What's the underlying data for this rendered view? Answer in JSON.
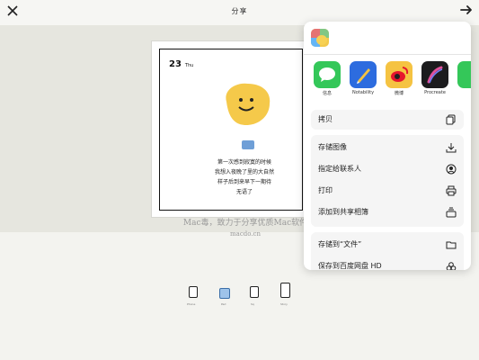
{
  "window": {
    "title": "分享"
  },
  "card": {
    "date_day": "23",
    "date_suffix": "Thu",
    "poem": [
      "第一次感到寂寞的时候",
      "我想入夜晚了里的大自然",
      "样子后到来早下一期待",
      "无语了"
    ]
  },
  "watermark": {
    "line1": "Mac毒，致力于分享优质Mac软件",
    "line2": "macdo.cn"
  },
  "frames": {
    "labels": [
      "Phone",
      "Pad",
      "Sq",
      "Story"
    ],
    "selected_index": 1
  },
  "share_sheet": {
    "apps": [
      {
        "label": "信息",
        "color": "#34c759",
        "icon": "messages-icon"
      },
      {
        "label": "Notability",
        "color": "#2d6cdf",
        "icon": "notability-icon"
      },
      {
        "label": "微博",
        "color": "#f5c342",
        "icon": "weibo-icon"
      },
      {
        "label": "Procreate",
        "color": "#1c1c1e",
        "icon": "procreate-icon"
      },
      {
        "label": "",
        "color": "#34c759",
        "icon": "partial-app-icon"
      }
    ],
    "copy_label": "拷贝",
    "group2": [
      "存储图像",
      "指定给联系人",
      "打印",
      "添加到共享相簿"
    ],
    "group3": [
      "存储到“文件”",
      "保存到百度网盘 HD"
    ]
  }
}
